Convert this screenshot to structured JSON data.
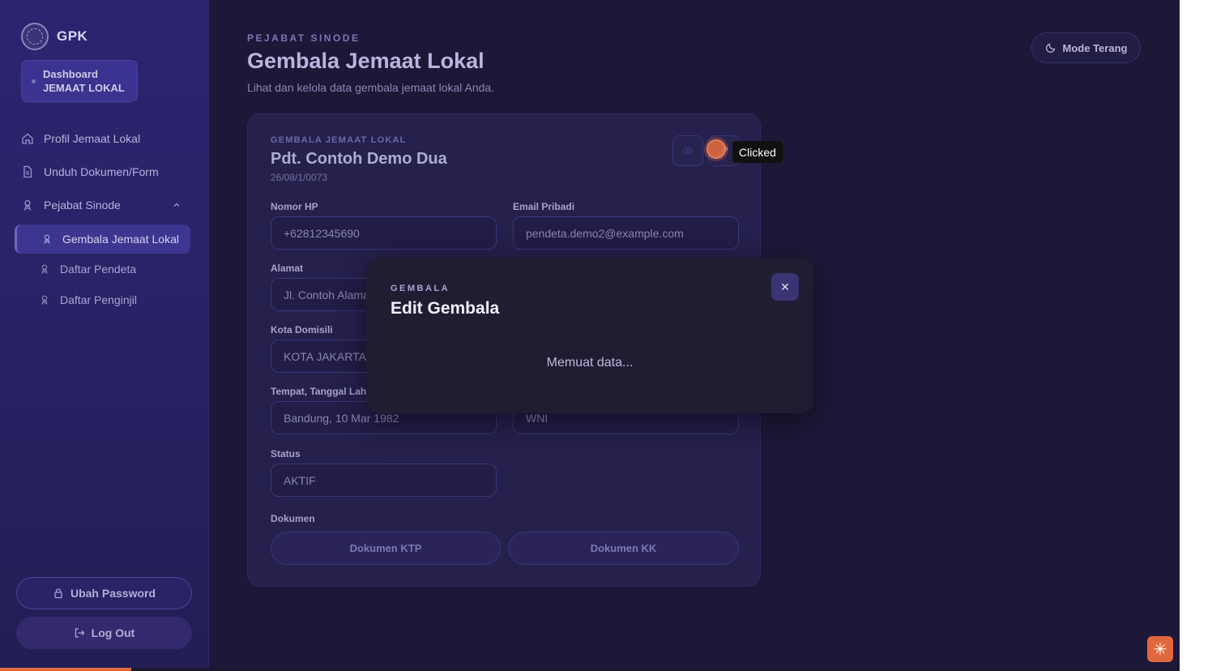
{
  "sidebar": {
    "brand": "GPK",
    "dashboard_line1": "Dashboard",
    "dashboard_line2": "JEMAAT LOKAL",
    "nav": [
      {
        "label": "Profil Jemaat Lokal",
        "icon": "home-icon"
      },
      {
        "label": "Unduh Dokumen/Form",
        "icon": "document-icon"
      },
      {
        "label": "Pejabat Sinode",
        "icon": "user-badge-icon"
      }
    ],
    "sub_items": [
      {
        "label": "Gembala Jemaat Lokal",
        "active": true
      },
      {
        "label": "Daftar Pendeta",
        "active": false
      },
      {
        "label": "Daftar Penginjil",
        "active": false
      }
    ],
    "change_password": "Ubah Password",
    "logout": "Log Out"
  },
  "header": {
    "eyebrow": "PEJABAT SINODE",
    "title": "Gembala Jemaat Lokal",
    "subtitle": "Lihat dan kelola data gembala jemaat lokal Anda.",
    "mode_toggle": "Mode Terang"
  },
  "card": {
    "eyebrow": "GEMBALA JEMAAT LOKAL",
    "name": "Pdt. Contoh Demo Dua",
    "code": "26/08/1/0073",
    "fields": {
      "phone_label": "Nomor HP",
      "phone_value": "+62812345690",
      "email_label": "Email Pribadi",
      "email_value": "pendeta.demo2@example.com",
      "address_label": "Alamat",
      "address_value": "Jl. Contoh Alamat",
      "city_label": "Kota Domisili",
      "city_value": "KOTA JAKARTA S",
      "birth_label": "Tempat, Tanggal Lahi",
      "birth_value": "Bandung, 10 Mar 1982",
      "citizenship_value": "WNI",
      "status_label": "Status",
      "status_value": "AKTIF"
    },
    "documents_label": "Dokumen",
    "doc_ktp": "Dokumen KTP",
    "doc_kk": "Dokumen KK"
  },
  "modal": {
    "eyebrow": "GEMBALA",
    "title": "Edit Gembala",
    "loading": "Memuat data...",
    "close_symbol": "✕"
  },
  "click_marker": {
    "label": "Clicked"
  },
  "colors": {
    "background": "#1d1838",
    "sidebar": "#2c2470",
    "modal": "#201d33",
    "accent": "#e0683e"
  }
}
